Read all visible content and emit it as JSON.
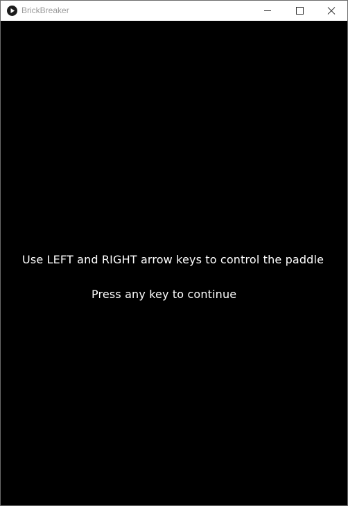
{
  "window": {
    "title": "BrickBreaker",
    "icon": "play-icon",
    "controls": [
      "minimize-icon",
      "maximize-icon",
      "close-icon"
    ]
  },
  "game": {
    "background_color": "#000000",
    "text_color": "#ffffff",
    "instructions": "Use LEFT and RIGHT arrow keys to control the paddle",
    "prompt": "Press any key to continue"
  }
}
